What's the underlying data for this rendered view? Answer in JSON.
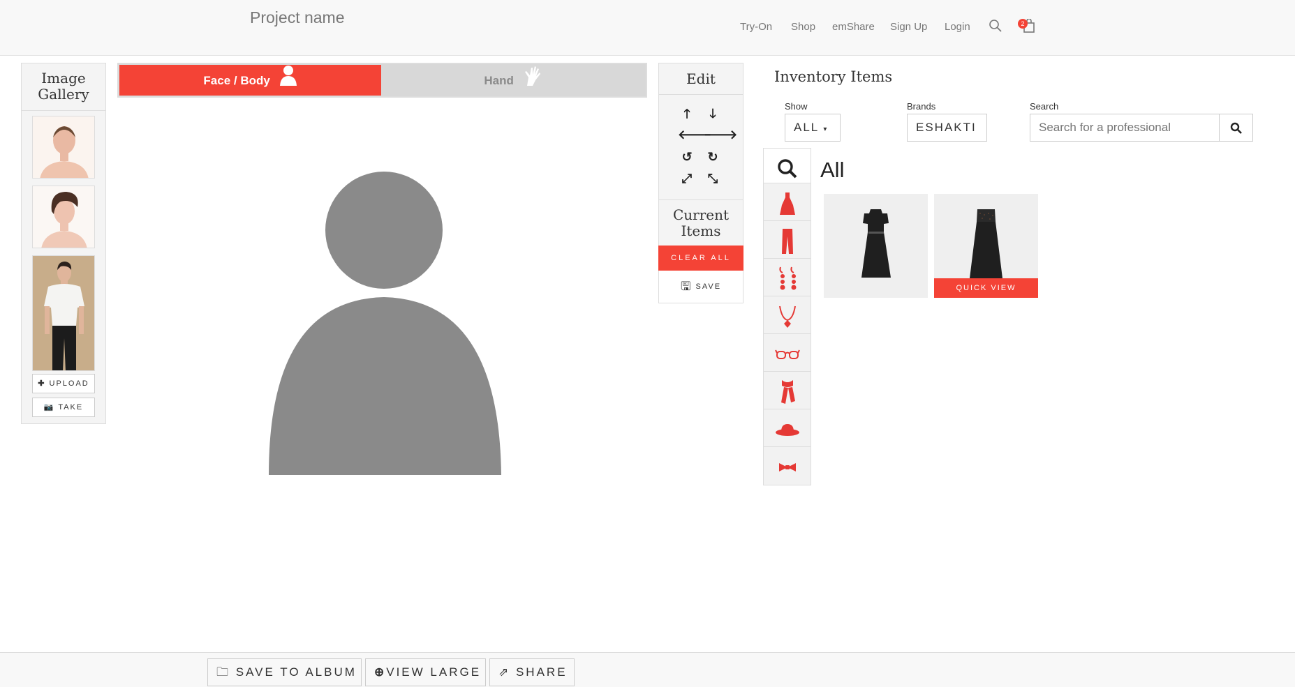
{
  "header": {
    "brand": "Project name",
    "nav": [
      "Try-On",
      "Shop",
      "emShare",
      "Sign Up",
      "Login"
    ],
    "cart_count": "2"
  },
  "gallery": {
    "title": "Image Gallery",
    "upload_label": "UPLOAD",
    "take_label": "TAKE"
  },
  "tabs": {
    "face_body": "Face / Body",
    "hand": "Hand"
  },
  "edit": {
    "title": "Edit",
    "current_items": "Current Items",
    "clear_all": "CLEAR ALL",
    "save": "SAVE"
  },
  "inventory": {
    "title": "Inventory Items",
    "show_label": "Show",
    "show_value": "ALL",
    "brands_label": "Brands",
    "brands_value": "ESHAKTI",
    "search_label": "Search",
    "search_placeholder": "Search for a professional",
    "heading": "All",
    "quick_view": "QUICK VIEW",
    "categories": [
      "search-icon",
      "dress-icon",
      "pants-icon",
      "earrings-icon",
      "necklace-icon",
      "glasses-icon",
      "scarf-icon",
      "hat-icon",
      "bowtie-icon"
    ]
  },
  "footer": {
    "save_to_album": "SAVE TO ALBUM",
    "view_large": "VIEW LARGE",
    "share": "SHARE"
  },
  "colors": {
    "accent": "#f44336",
    "silhouette": "#8a8a8a"
  }
}
